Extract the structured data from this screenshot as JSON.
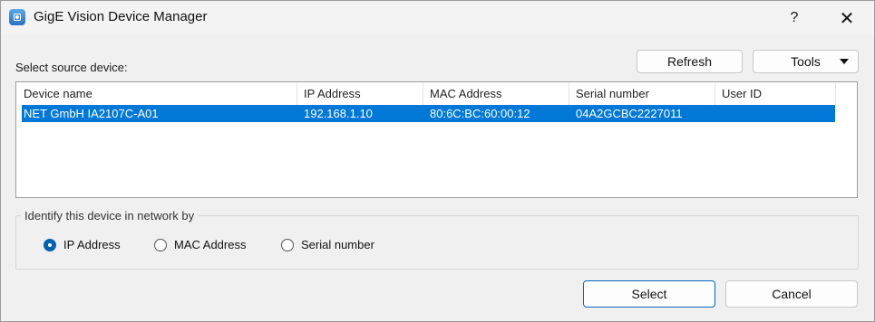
{
  "window": {
    "title": "GigE Vision Device Manager",
    "help_glyph": "?",
    "close_glyph": "✕"
  },
  "source": {
    "label": "Select source device:"
  },
  "toolbar": {
    "refresh_label": "Refresh",
    "tools_label": "Tools"
  },
  "table": {
    "columns": [
      "Device name",
      "IP Address",
      "MAC Address",
      "Serial number",
      "User ID"
    ],
    "rows": [
      {
        "device_name": "NET GmbH IA2107C-A01",
        "ip": "192.168.1.10",
        "mac": "80:6C:BC:60:00:12",
        "serial": "04A2GCBC2227011",
        "user_id": ""
      }
    ],
    "selected_row": 0
  },
  "identify": {
    "label": "Identify this device in network by",
    "options": [
      "IP Address",
      "MAC Address",
      "Serial number"
    ],
    "selected": "IP Address"
  },
  "footer": {
    "select_label": "Select",
    "cancel_label": "Cancel"
  },
  "colors": {
    "selection": "#0078d7",
    "accent": "#0063b1"
  }
}
